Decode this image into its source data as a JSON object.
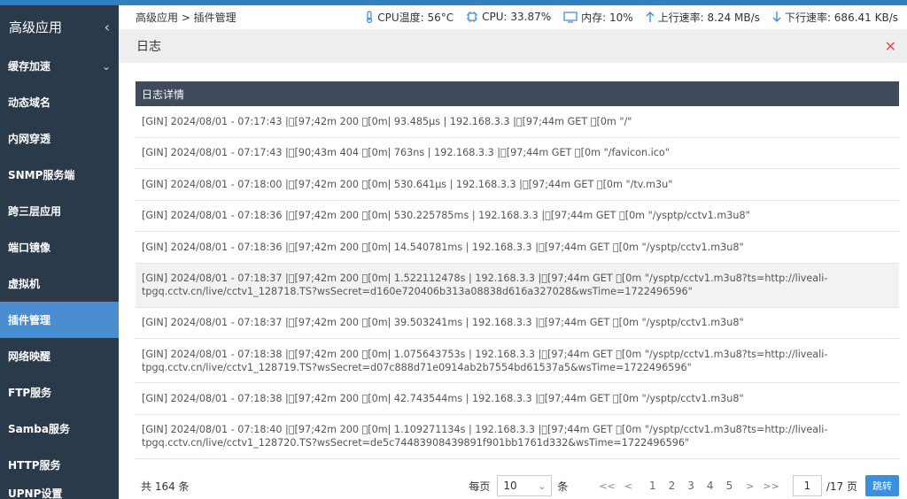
{
  "sidebar": {
    "title": "高级应用",
    "items": [
      {
        "label": "缓存加速",
        "expandable": true
      },
      {
        "label": "动态域名"
      },
      {
        "label": "内网穿透"
      },
      {
        "label": "SNMP服务端"
      },
      {
        "label": "跨三层应用"
      },
      {
        "label": "端口镜像"
      },
      {
        "label": "虚拟机"
      },
      {
        "label": "插件管理",
        "active": true
      },
      {
        "label": "网络映醒"
      },
      {
        "label": "FTP服务"
      },
      {
        "label": "Samba服务"
      },
      {
        "label": "HTTP服务"
      },
      {
        "label": "UPNP设置"
      }
    ]
  },
  "topbar": {
    "breadcrumb": "高级应用 > 插件管理",
    "cpu_temp": "CPU温度: 56°C",
    "cpu": "CPU: 33.87%",
    "memory": "内存: 10%",
    "upload": "上行速率: 8.24 MB/s",
    "download": "下行速率: 686.41 KB/s"
  },
  "panel": {
    "title": "日志"
  },
  "table": {
    "header": "日志详情",
    "rows": [
      "[GIN] 2024/08/01 - 07:17:43 |\u0000[97;42m 200 \u0000[0m| 93.485μs | 192.168.3.3 |\u0000[97;44m GET \u0000[0m \"/\"",
      "[GIN] 2024/08/01 - 07:17:43 |\u0000[90;43m 404 \u0000[0m| 763ns | 192.168.3.3 |\u0000[97;44m GET \u0000[0m \"/favicon.ico\"",
      "[GIN] 2024/08/01 - 07:18:00 |\u0000[97;42m 200 \u0000[0m| 530.641μs | 192.168.3.3 |\u0000[97;44m GET \u0000[0m \"/tv.m3u\"",
      "[GIN] 2024/08/01 - 07:18:36 |\u0000[97;42m 200 \u0000[0m| 530.225785ms | 192.168.3.3 |\u0000[97;44m GET \u0000[0m \"/ysptp/cctv1.m3u8\"",
      "[GIN] 2024/08/01 - 07:18:36 |\u0000[97;42m 200 \u0000[0m| 14.540781ms | 192.168.3.3 |\u0000[97;44m GET \u0000[0m \"/ysptp/cctv1.m3u8\"",
      "[GIN] 2024/08/01 - 07:18:37 |\u0000[97;42m 200 \u0000[0m| 1.522112478s | 192.168.3.3 |\u0000[97;44m GET \u0000[0m \"/ysptp/cctv1.m3u8?ts=http://liveali-\ntpgq.cctv.cn/live/cctv1_128718.TS?wsSecret=d160e720406b313a08838d616a327028&wsTime=1722496596\"",
      "[GIN] 2024/08/01 - 07:18:37 |\u0000[97;42m 200 \u0000[0m| 39.503241ms | 192.168.3.3 |\u0000[97;44m GET \u0000[0m \"/ysptp/cctv1.m3u8\"",
      "[GIN] 2024/08/01 - 07:18:38 |\u0000[97;42m 200 \u0000[0m| 1.075643753s | 192.168.3.3 |\u0000[97;44m GET \u0000[0m \"/ysptp/cctv1.m3u8?ts=http://liveali-\ntpgq.cctv.cn/live/cctv1_128719.TS?wsSecret=d07c888d71e0914ab2b7554bd61537a5&wsTime=1722496596\"",
      "[GIN] 2024/08/01 - 07:18:38 |\u0000[97;42m 200 \u0000[0m| 42.743544ms | 192.168.3.3 |\u0000[97;44m GET \u0000[0m \"/ysptp/cctv1.m3u8\"",
      "[GIN] 2024/08/01 - 07:18:40 |\u0000[97;42m 200 \u0000[0m| 1.109271134s | 192.168.3.3 |\u0000[97;44m GET \u0000[0m \"/ysptp/cctv1.m3u8?ts=http://liveali-\ntpgq.cctv.cn/live/cctv1_128720.TS?wsSecret=de5c74483908439891f901bb1761d332&wsTime=1722496596\""
    ]
  },
  "footer": {
    "total": "共 164 条",
    "per_page_label": "每页",
    "per_page_value": "10",
    "per_page_unit": "条",
    "first": "<<",
    "prev": "<",
    "pages": [
      "1",
      "2",
      "3",
      "4",
      "5"
    ],
    "next": ">",
    "last": ">>",
    "goto_value": "1",
    "pages_total": "/17 页",
    "jump_label": "跳转"
  },
  "colors": {
    "sidebar_bg": "#2b3a4a",
    "active": "#4a8dd0",
    "table_header": "#3f4a5c",
    "accent": "#3a87d2",
    "close": "#e2504a"
  }
}
